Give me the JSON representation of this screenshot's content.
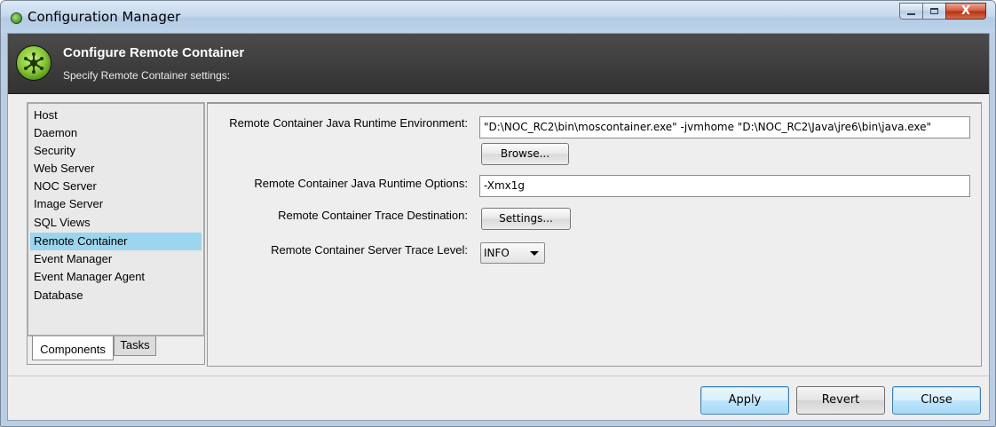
{
  "window": {
    "title": "Configuration Manager",
    "controls": {
      "minimize": "minimize",
      "maximize": "maximize",
      "close_glyph": "X"
    }
  },
  "header": {
    "title": "Configure Remote Container",
    "subtitle": "Specify Remote Container settings:"
  },
  "sidebar": {
    "items": [
      {
        "label": "Host"
      },
      {
        "label": "Daemon"
      },
      {
        "label": "Security"
      },
      {
        "label": "Web Server"
      },
      {
        "label": "NOC Server"
      },
      {
        "label": "Image Server"
      },
      {
        "label": "SQL Views"
      },
      {
        "label": "Remote Container",
        "selected": true
      },
      {
        "label": "Event Manager"
      },
      {
        "label": "Event Manager Agent"
      },
      {
        "label": "Database"
      }
    ],
    "tabs": [
      {
        "label": "Components",
        "active": true
      },
      {
        "label": "Tasks",
        "active": false
      }
    ]
  },
  "settings": {
    "jre": {
      "label": "Remote Container Java Runtime Environment:",
      "value": "\"D:\\NOC_RC2\\bin\\moscontainer.exe\" -jvmhome \"D:\\NOC_RC2\\Java\\jre6\\bin\\java.exe\"",
      "browse_label": "Browse..."
    },
    "options": {
      "label": "Remote Container Java Runtime Options:",
      "value": "-Xmx1g"
    },
    "trace_destination": {
      "label": "Remote Container Trace Destination:",
      "button_label": "Settings..."
    },
    "trace_level": {
      "label": "Remote Container Server Trace Level:",
      "selected": "INFO"
    }
  },
  "footer": {
    "apply_label": "Apply",
    "revert_label": "Revert",
    "close_label": "Close"
  },
  "colors": {
    "selection": "#9cd5ee",
    "header_bg": "#3f3f3f",
    "titlebar": "#c6d9ee"
  }
}
